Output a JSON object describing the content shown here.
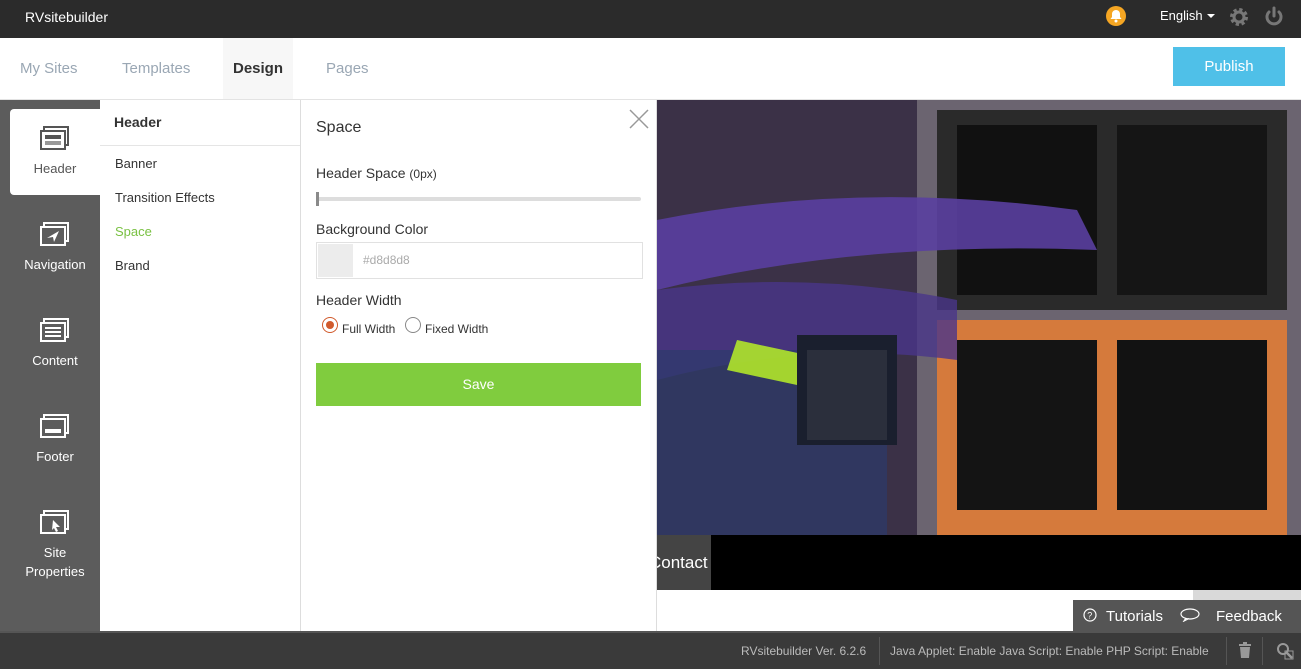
{
  "app": {
    "title": "RVsitebuilder"
  },
  "topbar": {
    "language": "English"
  },
  "tabs": [
    {
      "label": "My Sites"
    },
    {
      "label": "Templates"
    },
    {
      "label": "Design"
    },
    {
      "label": "Pages"
    }
  ],
  "publish_label": "Publish",
  "rail": [
    {
      "label": "Header",
      "icon": "header-icon"
    },
    {
      "label": "Navigation",
      "icon": "navigation-icon"
    },
    {
      "label": "Content",
      "icon": "content-icon"
    },
    {
      "label": "Footer",
      "icon": "footer-icon"
    },
    {
      "label": "Site",
      "label2": "Properties",
      "icon": "site-properties-icon"
    }
  ],
  "submenu": {
    "title": "Header",
    "items": [
      {
        "label": "Banner"
      },
      {
        "label": "Transition Effects"
      },
      {
        "label": "Space"
      },
      {
        "label": "Brand"
      }
    ]
  },
  "panel": {
    "title": "Space",
    "header_space_label": "Header Space",
    "header_space_value": "(0px)",
    "slider_value": 0,
    "bg_color_label": "Background Color",
    "bg_color_value": "#d8d8d8",
    "header_width_label": "Header Width",
    "options": [
      {
        "label": "Full Width",
        "selected": true
      },
      {
        "label": "Fixed Width",
        "selected": false
      }
    ],
    "save_label": "Save"
  },
  "preview": {
    "nav_item": "Contact Us",
    "tutorials": "Tutorials",
    "feedback": "Feedback"
  },
  "status": {
    "version": "RVsitebuilder Ver. 6.2.6",
    "env": "Java Applet: Enable Java Script: Enable PHP Script: Enable"
  },
  "colors": {
    "topbar": "#2b2b2b",
    "publish": "#4fc0e8",
    "save": "#80cc3e",
    "active_submenu": "#7ac143",
    "rail": "#5c5c5c"
  }
}
